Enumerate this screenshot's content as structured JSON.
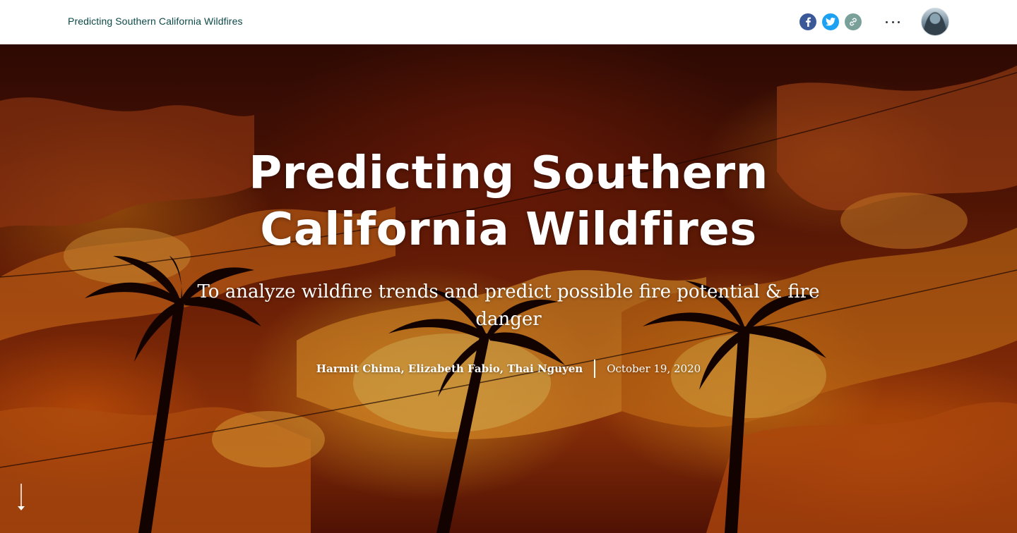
{
  "header": {
    "title": "Predicting Southern California Wildfires",
    "share": {
      "facebook_icon": "facebook-icon",
      "twitter_icon": "twitter-icon",
      "link_icon": "link-icon",
      "facebook_color": "#3b5998",
      "twitter_color": "#1da1f2",
      "link_color": "#7aa09a"
    },
    "more_icon": "more-horizontal-icon",
    "avatar_icon": "user-avatar"
  },
  "hero": {
    "title": "Predicting Southern California Wildfires",
    "subtitle": "To analyze wildfire trends and predict possible fire potential & fire danger",
    "authors": "Harmit Chima, Elizabeth Fabio, Thai Nguyen",
    "date": "October 19, 2020",
    "scroll_icon": "arrow-down-icon"
  }
}
